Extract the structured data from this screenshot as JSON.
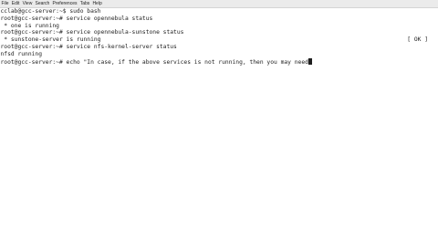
{
  "menubar": {
    "items": [
      "File",
      "Edit",
      "View",
      "Search",
      "Preferences",
      "Tabs",
      "Help"
    ]
  },
  "terminal": {
    "lines": [
      {
        "text": "cclab@gcc-server:~$ sudo bash",
        "right": ""
      },
      {
        "text": "root@gcc-server:~# service opennebula status",
        "right": ""
      },
      {
        "text": " * one is running",
        "right": ""
      },
      {
        "text": "root@gcc-server:~# service opennebula-sunstone status",
        "right": ""
      },
      {
        "text": " * sunstone-server is running",
        "right": "[ OK ]"
      },
      {
        "text": "root@gcc-server:~# service nfs-kernel-server status",
        "right": ""
      },
      {
        "text": "nfsd running",
        "right": ""
      },
      {
        "text": "root@gcc-server:~# echo \"In case, if the above services is not running, then you may need",
        "right": ""
      }
    ]
  }
}
